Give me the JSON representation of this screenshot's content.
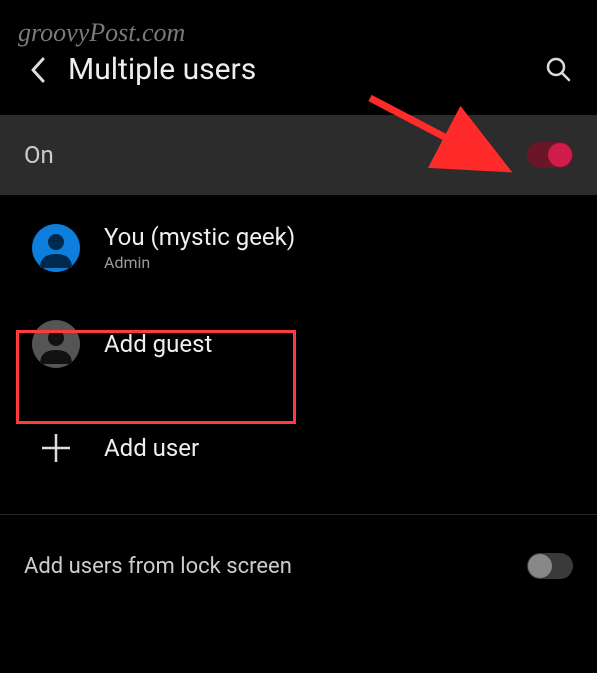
{
  "watermark": "groovyPost.com",
  "header": {
    "title": "Multiple users"
  },
  "main_toggle": {
    "label": "On",
    "enabled": true
  },
  "users": {
    "current": {
      "name": "You (mystic geek)",
      "role": "Admin"
    },
    "add_guest": {
      "label": "Add guest"
    },
    "add_user": {
      "label": "Add user"
    }
  },
  "lock_screen": {
    "label": "Add users from lock screen",
    "enabled": false
  },
  "colors": {
    "accent": "#d01c4a",
    "highlight": "#ff3b3b",
    "avatar_blue": "#0d7edb"
  }
}
